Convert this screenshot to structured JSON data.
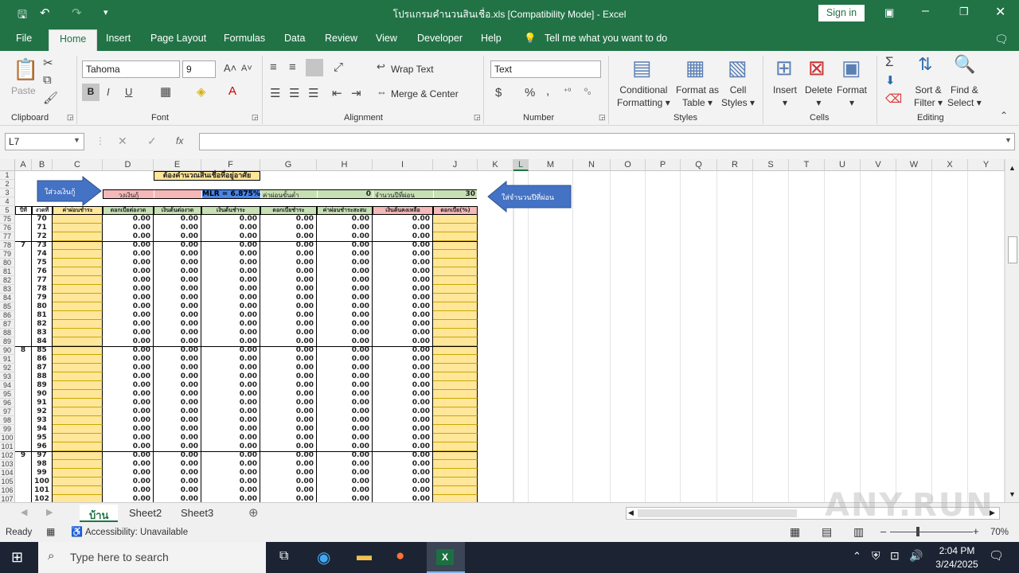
{
  "title": "โปรแกรมคำนวนสินเชื่อ.xls  [Compatibility Mode]  -  Excel",
  "sign_in": "Sign in",
  "tabs": [
    "File",
    "Home",
    "Insert",
    "Page Layout",
    "Formulas",
    "Data",
    "Review",
    "View",
    "Developer",
    "Help",
    "Tell me what you want to do"
  ],
  "ribbon": {
    "paste": "Paste",
    "font_name": "Tahoma",
    "font_size": "9",
    "wrap_text": "Wrap Text",
    "merge_center": "Merge & Center",
    "number_format": "Text",
    "conditional_formatting": [
      "Conditional",
      "Formatting"
    ],
    "format_as_table": [
      "Format as",
      "Table"
    ],
    "cell_styles": [
      "Cell",
      "Styles"
    ],
    "insert": "Insert",
    "delete": "Delete",
    "format": "Format",
    "sort_filter": [
      "Sort &",
      "Filter"
    ],
    "find_select": [
      "Find &",
      "Select"
    ],
    "groups": [
      "Clipboard",
      "Font",
      "Alignment",
      "Number",
      "Styles",
      "Cells",
      "Editing"
    ]
  },
  "namebox": "L7",
  "fx": "fx",
  "columns": [
    "A",
    "B",
    "C",
    "D",
    "E",
    "F",
    "G",
    "H",
    "I",
    "J",
    "K",
    "L",
    "M",
    "N",
    "O",
    "P",
    "Q",
    "R",
    "S",
    "T",
    "U",
    "V",
    "W",
    "X",
    "Y"
  ],
  "header_rows": [
    "1",
    "2",
    "3",
    "4",
    "5"
  ],
  "sheet_top": {
    "banner": "ต้องคำนวณสินเชื่อที่อยู่อาศัย",
    "label_loan": "วงเงินกู้",
    "mlr": "MLR = 6.875%",
    "label_fee": "ค่าผ่อนขั้นต่ำ",
    "fee_value": "0",
    "label_years": "จำนวนปีที่ผ่อน",
    "years_value": "30",
    "callout_left": "ใส่วงเงินกู้",
    "callout_right": "ใส่จำนวนปีที่ผ่อน",
    "headers": [
      "ปีที่",
      "งวดที่",
      "ค่าผ่อนชำระ",
      "ดอกเบี้ยต่องวด",
      "เงินต้นต่องวด",
      "เงินต้นชำระ",
      "ดอกเบี้ยชำระ",
      "ค่าผ่อนชำระสะสม",
      "เงินต้นคงเหลือ",
      "ดอกเบี้ย(%)"
    ]
  },
  "rows": [
    {
      "row": "75",
      "year": "",
      "period": "70"
    },
    {
      "row": "76",
      "year": "",
      "period": "71"
    },
    {
      "row": "77",
      "year": "",
      "period": "72"
    },
    {
      "row": "78",
      "year": "7",
      "period": "73"
    },
    {
      "row": "79",
      "year": "",
      "period": "74"
    },
    {
      "row": "80",
      "year": "",
      "period": "75"
    },
    {
      "row": "81",
      "year": "",
      "period": "76"
    },
    {
      "row": "82",
      "year": "",
      "period": "77"
    },
    {
      "row": "83",
      "year": "",
      "period": "78"
    },
    {
      "row": "84",
      "year": "",
      "period": "79"
    },
    {
      "row": "85",
      "year": "",
      "period": "80"
    },
    {
      "row": "86",
      "year": "",
      "period": "81"
    },
    {
      "row": "87",
      "year": "",
      "period": "82"
    },
    {
      "row": "88",
      "year": "",
      "period": "83"
    },
    {
      "row": "89",
      "year": "",
      "period": "84"
    },
    {
      "row": "90",
      "year": "8",
      "period": "85"
    },
    {
      "row": "91",
      "year": "",
      "period": "86"
    },
    {
      "row": "92",
      "year": "",
      "period": "87"
    },
    {
      "row": "93",
      "year": "",
      "period": "88"
    },
    {
      "row": "94",
      "year": "",
      "period": "89"
    },
    {
      "row": "95",
      "year": "",
      "period": "90"
    },
    {
      "row": "96",
      "year": "",
      "period": "91"
    },
    {
      "row": "97",
      "year": "",
      "period": "92"
    },
    {
      "row": "98",
      "year": "",
      "period": "93"
    },
    {
      "row": "99",
      "year": "",
      "period": "94"
    },
    {
      "row": "100",
      "year": "",
      "period": "95"
    },
    {
      "row": "101",
      "year": "",
      "period": "96"
    },
    {
      "row": "102",
      "year": "9",
      "period": "97"
    },
    {
      "row": "103",
      "year": "",
      "period": "98"
    },
    {
      "row": "104",
      "year": "",
      "period": "99"
    },
    {
      "row": "105",
      "year": "",
      "period": "100"
    },
    {
      "row": "106",
      "year": "",
      "period": "101"
    },
    {
      "row": "107",
      "year": "",
      "period": "102"
    }
  ],
  "zero_value": "0.00",
  "sheet_tabs": [
    "บ้าน",
    "Sheet2",
    "Sheet3"
  ],
  "status": {
    "ready": "Ready",
    "accessibility": "Accessibility: Unavailable",
    "zoom": "70%"
  },
  "taskbar": {
    "search": "Type here to search",
    "time": "2:04 PM",
    "date": "3/24/2025"
  },
  "watermark": "ANY.RUN",
  "colors": {
    "excel_green": "#217346",
    "input_yellow": "#ffe699",
    "header_green": "#c6e0b4",
    "pink": "#f4b8b8",
    "blue_arrow": "#4472c4"
  }
}
